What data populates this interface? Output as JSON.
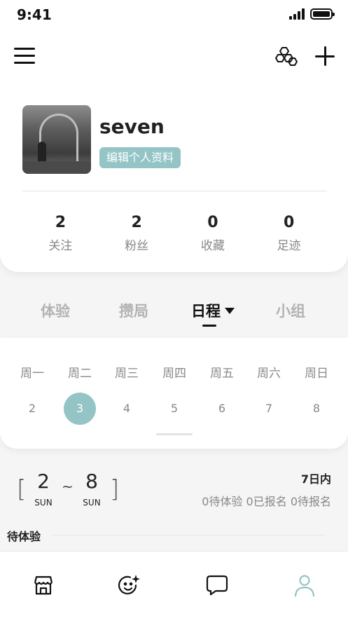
{
  "status_bar": {
    "time": "9:41"
  },
  "header": {
    "menu_icon": "menu-icon",
    "hex_icon": "hexagon-cluster-icon",
    "add_icon": "plus-icon"
  },
  "profile": {
    "username": "seven",
    "edit_label": "编辑个人资料",
    "stats": [
      {
        "value": "2",
        "label": "关注"
      },
      {
        "value": "2",
        "label": "粉丝"
      },
      {
        "value": "0",
        "label": "收藏"
      },
      {
        "value": "0",
        "label": "足迹"
      }
    ]
  },
  "tabs": [
    {
      "label": "体验",
      "active": false
    },
    {
      "label": "攒局",
      "active": false
    },
    {
      "label": "日程",
      "active": true
    },
    {
      "label": "小组",
      "active": false
    }
  ],
  "week": {
    "days": [
      "周一",
      "周二",
      "周三",
      "周四",
      "周五",
      "周六",
      "周日"
    ],
    "dates": [
      "2",
      "3",
      "4",
      "5",
      "6",
      "7",
      "8"
    ],
    "selected_date": "3"
  },
  "range": {
    "start": "2",
    "start_day": "SUN",
    "end": "8",
    "end_day": "SUN",
    "separator": "~",
    "title": "7日内",
    "summary": "0待体验 0已报名 0待报名"
  },
  "section": {
    "pending_label": "待体验"
  },
  "tabbar": {
    "items": [
      "store-icon",
      "smiley-sparkle-icon",
      "chat-bubble-icon",
      "profile-icon"
    ],
    "active_color": "#94c4c6"
  },
  "colors": {
    "accent": "#94c4c6"
  }
}
